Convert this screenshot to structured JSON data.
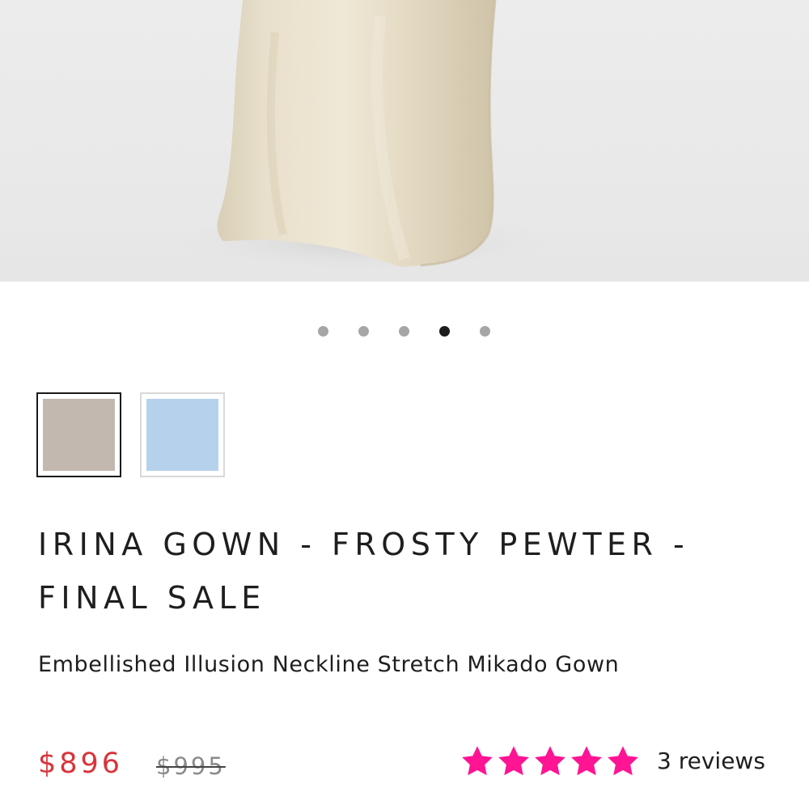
{
  "gallery": {
    "image_alt": "Gown skirt in frosty pewter satin",
    "slide_count": 5,
    "active_slide": 4
  },
  "swatches": [
    {
      "name": "frosty-pewter",
      "color": "#c2b8b0",
      "selected": true
    },
    {
      "name": "light-blue",
      "color": "#b6d1eb",
      "selected": false
    }
  ],
  "product": {
    "title": "IRINA GOWN - FROSTY PEWTER - FINAL SALE",
    "subtitle": "Embellished Illusion Neckline Stretch Mikado Gown"
  },
  "pricing": {
    "price": "$896",
    "compare_at": "$995",
    "sale_color": "#d9333a"
  },
  "rating": {
    "stars": 5,
    "star_color": "#ff1493",
    "reviews_label": "3 reviews"
  }
}
